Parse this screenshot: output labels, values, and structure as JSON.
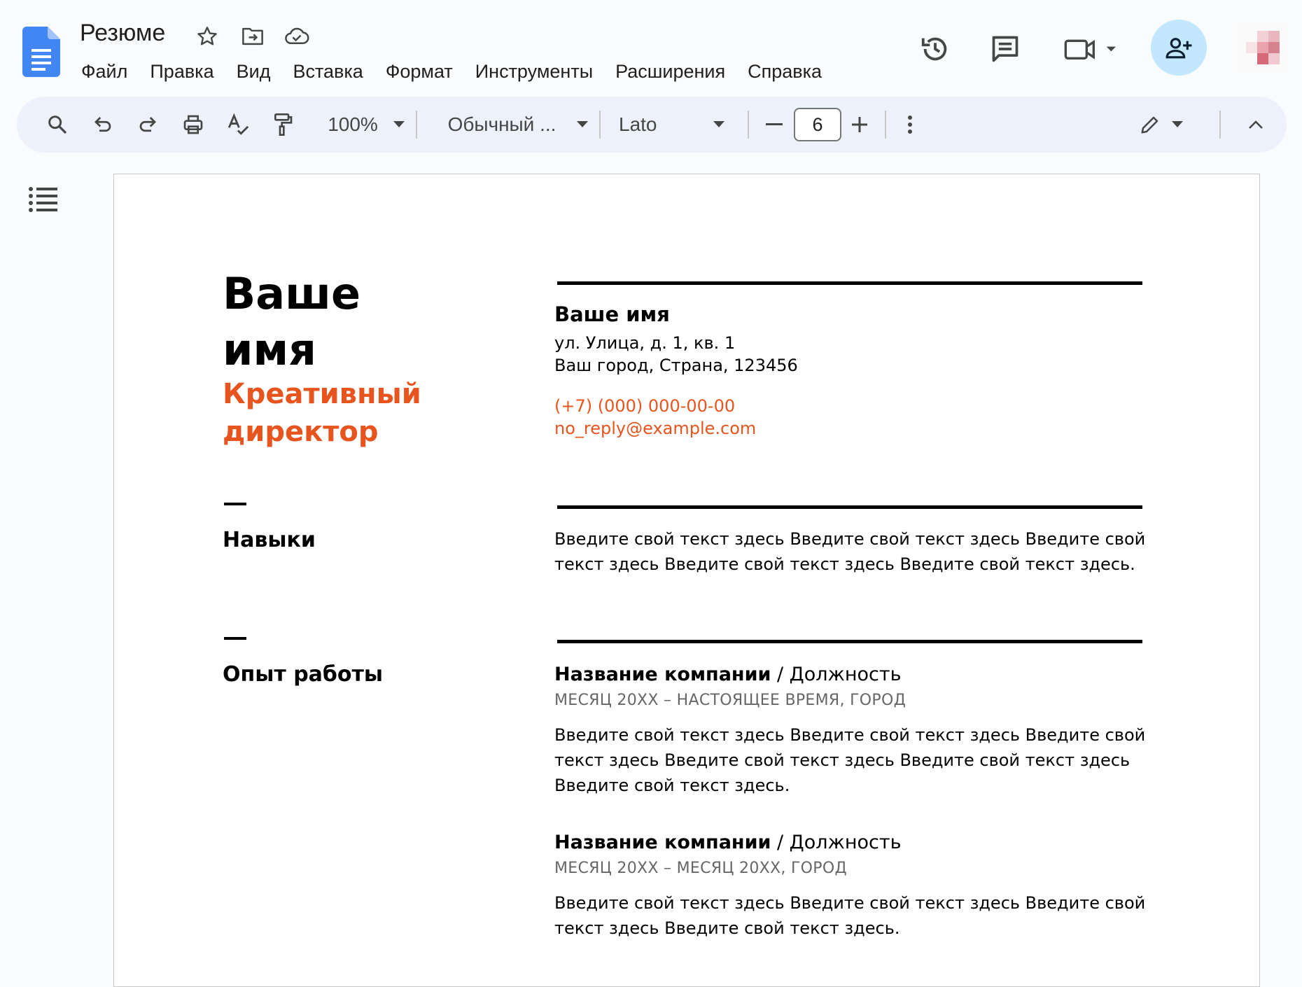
{
  "app": {
    "doc_title": "Резюме",
    "menu": [
      "Файл",
      "Правка",
      "Вид",
      "Вставка",
      "Формат",
      "Инструменты",
      "Расширения",
      "Справка"
    ]
  },
  "toolbar": {
    "zoom": "100%",
    "style": "Обычный ...",
    "font": "Lato",
    "font_size": "6"
  },
  "colors": {
    "accent": "#e8541e",
    "docs_blue": "#4285f4",
    "share_bg": "#c2e7ff"
  },
  "resume": {
    "name_big_line1": "Ваше",
    "name_big_line2": "имя",
    "role_line1": "Креативный",
    "role_line2": "директор",
    "contact_name": "Ваше имя",
    "address1": "ул. Улица, д. 1, кв. 1",
    "address2": "Ваш город, Страна, 123456",
    "phone": "(+7) (000) 000-00-00",
    "email": "no_reply@example.com",
    "skills_label": "Навыки",
    "skills_text": "Введите свой текст здесь Введите свой текст здесь Введите свой текст здесь Введите свой текст здесь Введите свой текст здесь.",
    "experience_label": "Опыт работы",
    "jobs": [
      {
        "company": "Название компании",
        "title": " / Должность",
        "meta": "МЕСЯЦ 20XX – НАСТОЯЩЕЕ ВРЕМЯ, ГОРОД",
        "text": "Введите свой текст здесь Введите свой текст здесь Введите свой текст здесь Введите свой текст здесь Введите свой текст здесь Введите свой текст здесь."
      },
      {
        "company": "Название компании",
        "title": " / Должность",
        "meta": "МЕСЯЦ 20XX – МЕСЯЦ 20XX, ГОРОД",
        "text": "Введите свой текст здесь Введите свой текст здесь Введите свой текст здесь Введите свой текст здесь."
      }
    ]
  },
  "icons": [
    "docs-logo-icon",
    "star-icon",
    "move-to-folder-icon",
    "cloud-saved-icon",
    "history-icon",
    "comments-icon",
    "meet-icon",
    "share-icon",
    "search-icon",
    "undo-icon",
    "redo-icon",
    "print-icon",
    "spellcheck-icon",
    "paint-format-icon",
    "more-icon",
    "edit-mode-icon",
    "collapse-icon",
    "outline-icon"
  ]
}
